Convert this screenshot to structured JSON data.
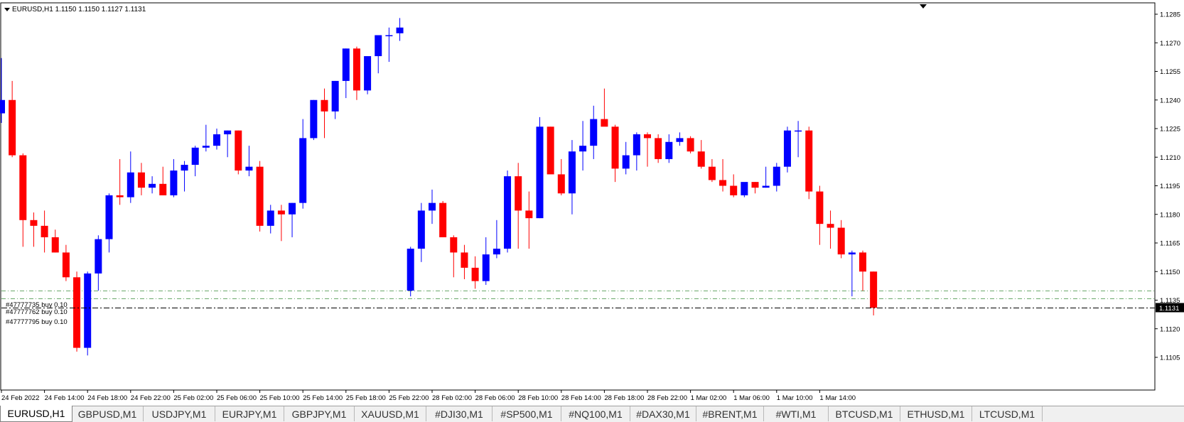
{
  "window": {
    "info": "EURUSD,H1  1.1150 1.1150 1.1127 1.1131"
  },
  "orders": [
    {
      "label": "#47777735 buy 0.10",
      "price": 1.114
    },
    {
      "label": "#47777762 buy 0.10",
      "price": 1.1136
    },
    {
      "label": "#47777795 buy 0.10",
      "price": 1.1131
    }
  ],
  "current_price_label": "1.1131",
  "chart_data": {
    "type": "candlestick",
    "symbol": "EURUSD",
    "timeframe": "H1",
    "ylim": [
      1.11,
      1.129
    ],
    "y_ticks": [
      "1.1285",
      "1.1270",
      "1.1255",
      "1.1240",
      "1.1225",
      "1.1210",
      "1.1195",
      "1.1180",
      "1.1165",
      "1.1150",
      "1.1135",
      "1.1120",
      "1.1105"
    ],
    "x_ticks": [
      {
        "label": "24 Feb 2022",
        "bar": 0
      },
      {
        "label": "24 Feb 14:00",
        "bar": 4
      },
      {
        "label": "24 Feb 18:00",
        "bar": 8
      },
      {
        "label": "24 Feb 22:00",
        "bar": 12
      },
      {
        "label": "25 Feb 02:00",
        "bar": 16
      },
      {
        "label": "25 Feb 06:00",
        "bar": 20
      },
      {
        "label": "25 Feb 10:00",
        "bar": 24
      },
      {
        "label": "25 Feb 14:00",
        "bar": 28
      },
      {
        "label": "25 Feb 18:00",
        "bar": 32
      },
      {
        "label": "25 Feb 22:00",
        "bar": 36
      },
      {
        "label": "28 Feb 02:00",
        "bar": 40
      },
      {
        "label": "28 Feb 06:00",
        "bar": 44
      },
      {
        "label": "28 Feb 10:00",
        "bar": 48
      },
      {
        "label": "28 Feb 14:00",
        "bar": 52
      },
      {
        "label": "28 Feb 18:00",
        "bar": 56
      },
      {
        "label": "28 Feb 22:00",
        "bar": 60
      },
      {
        "label": "1 Mar 02:00",
        "bar": 64
      },
      {
        "label": "1 Mar 06:00",
        "bar": 68
      },
      {
        "label": "1 Mar 10:00",
        "bar": 72
      },
      {
        "label": "1 Mar 14:00",
        "bar": 76
      }
    ],
    "candles": [
      {
        "o": 1.1233,
        "h": 1.1262,
        "l": 1.1228,
        "c": 1.124
      },
      {
        "o": 1.124,
        "h": 1.125,
        "l": 1.121,
        "c": 1.1211
      },
      {
        "o": 1.1211,
        "h": 1.1212,
        "l": 1.1163,
        "c": 1.1177
      },
      {
        "o": 1.1177,
        "h": 1.1181,
        "l": 1.1163,
        "c": 1.1174
      },
      {
        "o": 1.1174,
        "h": 1.1182,
        "l": 1.116,
        "c": 1.1168
      },
      {
        "o": 1.1168,
        "h": 1.1172,
        "l": 1.116,
        "c": 1.116
      },
      {
        "o": 1.116,
        "h": 1.1164,
        "l": 1.1145,
        "c": 1.1147
      },
      {
        "o": 1.1147,
        "h": 1.115,
        "l": 1.1108,
        "c": 1.111
      },
      {
        "o": 1.111,
        "h": 1.115,
        "l": 1.1106,
        "c": 1.1149
      },
      {
        "o": 1.1149,
        "h": 1.1169,
        "l": 1.114,
        "c": 1.1167
      },
      {
        "o": 1.1167,
        "h": 1.1191,
        "l": 1.116,
        "c": 1.119
      },
      {
        "o": 1.119,
        "h": 1.1209,
        "l": 1.1185,
        "c": 1.1189
      },
      {
        "o": 1.1189,
        "h": 1.1213,
        "l": 1.1186,
        "c": 1.1202
      },
      {
        "o": 1.1202,
        "h": 1.1207,
        "l": 1.119,
        "c": 1.1194
      },
      {
        "o": 1.1194,
        "h": 1.12,
        "l": 1.1191,
        "c": 1.1196
      },
      {
        "o": 1.1196,
        "h": 1.1205,
        "l": 1.119,
        "c": 1.119
      },
      {
        "o": 1.119,
        "h": 1.1209,
        "l": 1.1189,
        "c": 1.1203
      },
      {
        "o": 1.1203,
        "h": 1.1208,
        "l": 1.1192,
        "c": 1.1206
      },
      {
        "o": 1.1206,
        "h": 1.1216,
        "l": 1.12,
        "c": 1.1215
      },
      {
        "o": 1.1215,
        "h": 1.1227,
        "l": 1.1213,
        "c": 1.1216
      },
      {
        "o": 1.1216,
        "h": 1.1225,
        "l": 1.1214,
        "c": 1.1222
      },
      {
        "o": 1.1222,
        "h": 1.1224,
        "l": 1.121,
        "c": 1.1224
      },
      {
        "o": 1.1224,
        "h": 1.1224,
        "l": 1.1201,
        "c": 1.1203
      },
      {
        "o": 1.1203,
        "h": 1.1216,
        "l": 1.12,
        "c": 1.1205
      },
      {
        "o": 1.1205,
        "h": 1.1208,
        "l": 1.1171,
        "c": 1.1174
      },
      {
        "o": 1.1174,
        "h": 1.1185,
        "l": 1.117,
        "c": 1.1182
      },
      {
        "o": 1.1182,
        "h": 1.1185,
        "l": 1.1166,
        "c": 1.118
      },
      {
        "o": 1.118,
        "h": 1.1186,
        "l": 1.1168,
        "c": 1.1186
      },
      {
        "o": 1.1186,
        "h": 1.123,
        "l": 1.1183,
        "c": 1.122
      },
      {
        "o": 1.122,
        "h": 1.124,
        "l": 1.1219,
        "c": 1.124
      },
      {
        "o": 1.124,
        "h": 1.1246,
        "l": 1.122,
        "c": 1.1234
      },
      {
        "o": 1.1234,
        "h": 1.125,
        "l": 1.123,
        "c": 1.125
      },
      {
        "o": 1.125,
        "h": 1.1267,
        "l": 1.1241,
        "c": 1.1267
      },
      {
        "o": 1.1267,
        "h": 1.1268,
        "l": 1.124,
        "c": 1.1245
      },
      {
        "o": 1.1245,
        "h": 1.1263,
        "l": 1.1243,
        "c": 1.1263
      },
      {
        "o": 1.1263,
        "h": 1.1269,
        "l": 1.1254,
        "c": 1.1274
      },
      {
        "o": 1.1274,
        "h": 1.1278,
        "l": 1.126,
        "c": 1.1274
      },
      {
        "o": 1.1275,
        "h": 1.1283,
        "l": 1.1271,
        "c": 1.1278
      },
      {
        "o": 1.114,
        "h": 1.1163,
        "l": 1.1137,
        "c": 1.1162
      },
      {
        "o": 1.1162,
        "h": 1.1186,
        "l": 1.1155,
        "c": 1.1182
      },
      {
        "o": 1.1182,
        "h": 1.1193,
        "l": 1.1175,
        "c": 1.1186
      },
      {
        "o": 1.1186,
        "h": 1.1187,
        "l": 1.1168,
        "c": 1.1168
      },
      {
        "o": 1.1168,
        "h": 1.1169,
        "l": 1.1147,
        "c": 1.116
      },
      {
        "o": 1.116,
        "h": 1.1164,
        "l": 1.1146,
        "c": 1.1152
      },
      {
        "o": 1.1152,
        "h": 1.1158,
        "l": 1.1141,
        "c": 1.1145
      },
      {
        "o": 1.1145,
        "h": 1.1168,
        "l": 1.1143,
        "c": 1.1159
      },
      {
        "o": 1.1159,
        "h": 1.1177,
        "l": 1.1157,
        "c": 1.1162
      },
      {
        "o": 1.1162,
        "h": 1.1203,
        "l": 1.116,
        "c": 1.12
      },
      {
        "o": 1.12,
        "h": 1.1207,
        "l": 1.1162,
        "c": 1.1182
      },
      {
        "o": 1.1182,
        "h": 1.1192,
        "l": 1.1162,
        "c": 1.1178
      },
      {
        "o": 1.1178,
        "h": 1.1231,
        "l": 1.1178,
        "c": 1.1226
      },
      {
        "o": 1.1226,
        "h": 1.1226,
        "l": 1.1202,
        "c": 1.1201
      },
      {
        "o": 1.1201,
        "h": 1.1209,
        "l": 1.119,
        "c": 1.1191
      },
      {
        "o": 1.1191,
        "h": 1.1219,
        "l": 1.118,
        "c": 1.1213
      },
      {
        "o": 1.1213,
        "h": 1.1229,
        "l": 1.1203,
        "c": 1.1216
      },
      {
        "o": 1.1216,
        "h": 1.1237,
        "l": 1.1209,
        "c": 1.123
      },
      {
        "o": 1.123,
        "h": 1.1246,
        "l": 1.123,
        "c": 1.1226
      },
      {
        "o": 1.1226,
        "h": 1.1227,
        "l": 1.1197,
        "c": 1.1204
      },
      {
        "o": 1.1204,
        "h": 1.1218,
        "l": 1.1201,
        "c": 1.1211
      },
      {
        "o": 1.1211,
        "h": 1.1223,
        "l": 1.1203,
        "c": 1.1222
      },
      {
        "o": 1.1222,
        "h": 1.1223,
        "l": 1.1205,
        "c": 1.122
      },
      {
        "o": 1.122,
        "h": 1.1222,
        "l": 1.1207,
        "c": 1.1209
      },
      {
        "o": 1.1209,
        "h": 1.1222,
        "l": 1.1207,
        "c": 1.1218
      },
      {
        "o": 1.1218,
        "h": 1.1223,
        "l": 1.1216,
        "c": 1.122
      },
      {
        "o": 1.122,
        "h": 1.1221,
        "l": 1.1212,
        "c": 1.1213
      },
      {
        "o": 1.1213,
        "h": 1.1219,
        "l": 1.1204,
        "c": 1.1205
      },
      {
        "o": 1.1205,
        "h": 1.1209,
        "l": 1.1197,
        "c": 1.1198
      },
      {
        "o": 1.1198,
        "h": 1.1209,
        "l": 1.1192,
        "c": 1.1195
      },
      {
        "o": 1.1195,
        "h": 1.1201,
        "l": 1.1189,
        "c": 1.119
      },
      {
        "o": 1.119,
        "h": 1.1196,
        "l": 1.1189,
        "c": 1.1197
      },
      {
        "o": 1.1197,
        "h": 1.1197,
        "l": 1.1191,
        "c": 1.1194
      },
      {
        "o": 1.1194,
        "h": 1.1205,
        "l": 1.1194,
        "c": 1.1195
      },
      {
        "o": 1.1195,
        "h": 1.1207,
        "l": 1.1192,
        "c": 1.1205
      },
      {
        "o": 1.1205,
        "h": 1.1226,
        "l": 1.1202,
        "c": 1.1224
      },
      {
        "o": 1.1224,
        "h": 1.1229,
        "l": 1.121,
        "c": 1.1224
      },
      {
        "o": 1.1224,
        "h": 1.1226,
        "l": 1.1188,
        "c": 1.1192
      },
      {
        "o": 1.1192,
        "h": 1.1195,
        "l": 1.1164,
        "c": 1.1175
      },
      {
        "o": 1.1175,
        "h": 1.1182,
        "l": 1.1162,
        "c": 1.1173
      },
      {
        "o": 1.1173,
        "h": 1.1177,
        "l": 1.1157,
        "c": 1.1159
      },
      {
        "o": 1.1159,
        "h": 1.1161,
        "l": 1.1137,
        "c": 1.116
      },
      {
        "o": 1.116,
        "h": 1.1161,
        "l": 1.114,
        "c": 1.115
      },
      {
        "o": 1.115,
        "h": 1.115,
        "l": 1.1127,
        "c": 1.1131
      }
    ],
    "colors": {
      "bull": "#0000ff",
      "bear": "#ff0000",
      "order_line": "#6aa86a",
      "price_line": "#000000"
    }
  },
  "tabs": [
    {
      "label": "EURUSD,H1",
      "active": true
    },
    {
      "label": "GBPUSD,M1"
    },
    {
      "label": "USDJPY,M1"
    },
    {
      "label": "EURJPY,M1"
    },
    {
      "label": "GBPJPY,M1"
    },
    {
      "label": "XAUUSD,M1"
    },
    {
      "label": "#DJI30,M1"
    },
    {
      "label": "#SP500,M1"
    },
    {
      "label": "#NQ100,M1"
    },
    {
      "label": "#DAX30,M1"
    },
    {
      "label": "#BRENT,M1"
    },
    {
      "label": "#WTI,M1"
    },
    {
      "label": "BTCUSD,M1"
    },
    {
      "label": "ETHUSD,M1"
    },
    {
      "label": "LTCUSD,M1"
    }
  ]
}
